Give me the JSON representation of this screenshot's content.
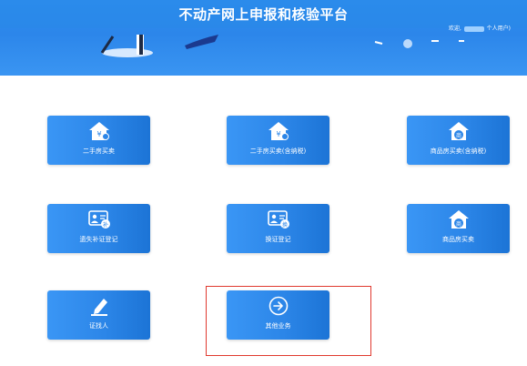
{
  "header": {
    "title": "不动产网上申报和核验平台",
    "user_prefix": "欢迎,",
    "user_suffix": "个人用户)"
  },
  "tiles": [
    {
      "label": "二手房买卖",
      "icon": "house-yen-icon"
    },
    {
      "label": "二手房买卖(含纳税)",
      "icon": "house-yen-icon"
    },
    {
      "label": "商品房买卖(含纳税)",
      "icon": "house-shop-icon"
    },
    {
      "label": "遗失补证登记",
      "icon": "certificate-replace-icon"
    },
    {
      "label": "换证登记",
      "icon": "certificate-exchange-icon"
    },
    {
      "label": "商品房买卖",
      "icon": "house-shop-icon"
    },
    {
      "label": "证找人",
      "icon": "pen-edit-icon"
    },
    {
      "label": "其他业务",
      "icon": "arrow-right-circle-icon"
    }
  ],
  "colors": {
    "header": "#2f8ff0",
    "tile": "#2c86e8",
    "highlight": "#e0392f"
  }
}
